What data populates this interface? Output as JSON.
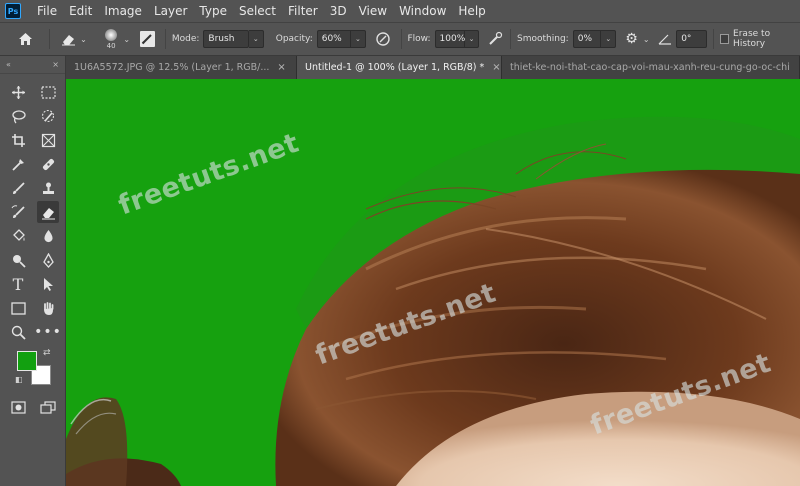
{
  "app": {
    "logo": "Ps"
  },
  "menu": [
    "File",
    "Edit",
    "Image",
    "Layer",
    "Type",
    "Select",
    "Filter",
    "3D",
    "View",
    "Window",
    "Help"
  ],
  "options": {
    "brush_size": "40",
    "mode_label": "Mode:",
    "mode_value": "Brush",
    "opacity_label": "Opacity:",
    "opacity_value": "60%",
    "flow_label": "Flow:",
    "flow_value": "100%",
    "smoothing_label": "Smoothing:",
    "smoothing_value": "0%",
    "angle_value": "0°",
    "erase_to_history_label": "Erase to History"
  },
  "tabs": [
    {
      "label": "1U6A5572.JPG @ 12.5% (Layer 1, RGB/...",
      "active": false
    },
    {
      "label": "Untitled-1 @ 100% (Layer 1, RGB/8) *",
      "active": true
    },
    {
      "label": "thiet-ke-noi-that-cao-cap-voi-mau-xanh-reu-cung-go-oc-chi",
      "active": false
    }
  ],
  "toolbar": {
    "grip_left": "«",
    "grip_right": "×"
  },
  "colors": {
    "foreground": "#12a010",
    "background": "#ffffff",
    "canvas_green": "#16a10f"
  },
  "watermarks": [
    "freetuts.net",
    "freetuts.net",
    "freetuts.net",
    "freetuts.net"
  ]
}
